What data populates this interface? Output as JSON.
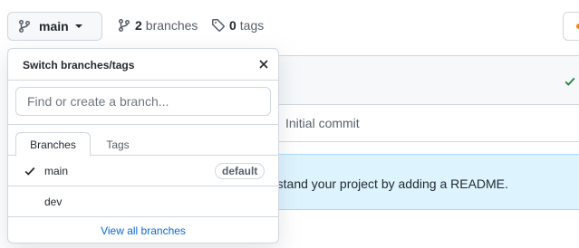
{
  "topbar": {
    "branch_button_label": "main",
    "branches_count": "2",
    "branches_label": "branches",
    "tags_count": "0",
    "tags_label": "tags",
    "icons": {
      "branch": "git-branch-icon",
      "tag": "tag-icon",
      "caret": "caret-down-icon"
    }
  },
  "background": {
    "commit_message": "Initial commit",
    "readme_banner": "rstand your project by adding a README.",
    "status_icon": "check-icon",
    "colors": {
      "success": "#1a7f37",
      "banner_bg": "#ddf4ff",
      "accent_dot": "#fb8500"
    }
  },
  "dropdown": {
    "title": "Switch branches/tags",
    "search_placeholder": "Find or create a branch...",
    "tabs": [
      {
        "label": "Branches",
        "active": true
      },
      {
        "label": "Tags",
        "active": false
      }
    ],
    "branches": [
      {
        "name": "main",
        "selected": true,
        "badge": "default"
      },
      {
        "name": "dev",
        "selected": false,
        "badge": ""
      }
    ],
    "footer_link": "View all branches",
    "colors": {
      "link": "#0969da",
      "border": "#d0d7de"
    }
  }
}
